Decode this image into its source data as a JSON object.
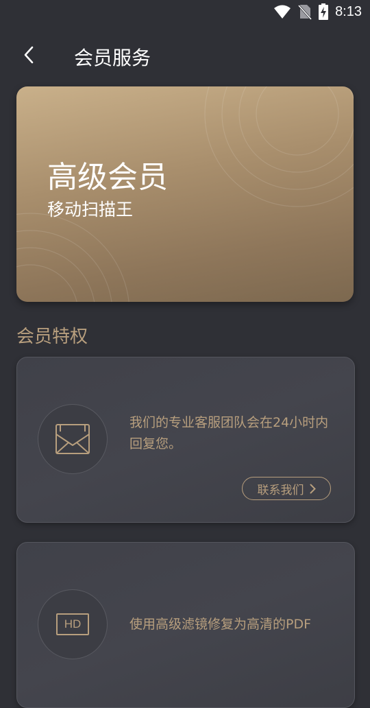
{
  "status_bar": {
    "time": "8:13"
  },
  "header": {
    "title": "会员服务"
  },
  "card": {
    "title": "高级会员",
    "subtitle": "移动扫描王"
  },
  "section": {
    "title": "会员特权"
  },
  "benefits": [
    {
      "icon": "mail-icon",
      "text": "我们的专业客服团队会在24小时内回复您。",
      "button_label": "联系我们"
    },
    {
      "icon": "hd-icon",
      "badge": "HD",
      "text": "使用高级滤镜修复为高清的PDF"
    }
  ],
  "colors": {
    "background": "#2f3036",
    "accent": "#b89f7e",
    "card_gold": "#a98f6d"
  }
}
